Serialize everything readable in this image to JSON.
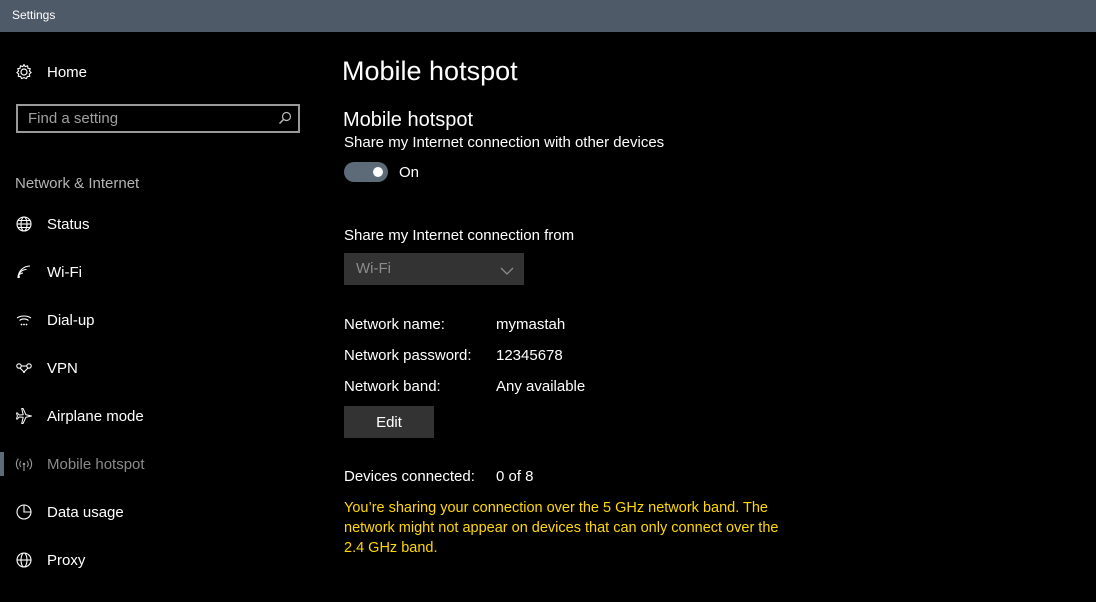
{
  "window": {
    "title": "Settings"
  },
  "sidebar": {
    "home_label": "Home",
    "search": {
      "placeholder": "Find a setting"
    },
    "section_header": "Network & Internet",
    "items": [
      {
        "label": "Status",
        "icon": "globe-icon"
      },
      {
        "label": "Wi-Fi",
        "icon": "wifi-icon"
      },
      {
        "label": "Dial-up",
        "icon": "dialup-icon"
      },
      {
        "label": "VPN",
        "icon": "vpn-icon"
      },
      {
        "label": "Airplane mode",
        "icon": "airplane-icon"
      },
      {
        "label": "Mobile hotspot",
        "icon": "hotspot-icon",
        "selected": true
      },
      {
        "label": "Data usage",
        "icon": "pie-chart-icon"
      },
      {
        "label": "Proxy",
        "icon": "globe-icon"
      }
    ]
  },
  "main": {
    "page_title": "Mobile hotspot",
    "section_title": "Mobile hotspot",
    "share_description": "Share my Internet connection with other devices",
    "toggle": {
      "state_label": "On",
      "on": true
    },
    "share_from_label": "Share my Internet connection from",
    "share_from_value": "Wi-Fi",
    "network_name_label": "Network name:",
    "network_name_value": "mymastah",
    "network_password_label": "Network password:",
    "network_password_value": "12345678",
    "network_band_label": "Network band:",
    "network_band_value": "Any available",
    "edit_label": "Edit",
    "devices_label": "Devices connected:",
    "devices_value": "0 of 8",
    "warning_text": "You’re sharing your connection over the 5 GHz network band. The network might not appear on devices that can only connect over the 2.4 GHz band."
  },
  "colors": {
    "background": "#000000",
    "titlebar": "#4e5a67",
    "accent": "#5d6b79",
    "warning": "#ffd800",
    "control": "#333333"
  }
}
